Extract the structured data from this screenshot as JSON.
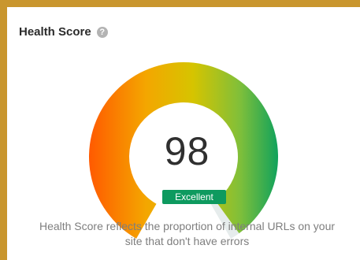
{
  "card": {
    "title": "Health Score",
    "help_icon": "question-circle-icon",
    "score": "98",
    "status": "Excellent",
    "description_line1": "Health Score reflects the proportion of internal URLs on your",
    "description_line2": "site that don't have errors"
  },
  "gauge": {
    "value": 98,
    "max": 100,
    "colors": {
      "low": "#ff5a00",
      "mid": "#f2b400",
      "high_mid": "#9fc536",
      "high": "#16a05a",
      "remaining": "#e6ecec",
      "badge": "#0e9a5f"
    }
  }
}
